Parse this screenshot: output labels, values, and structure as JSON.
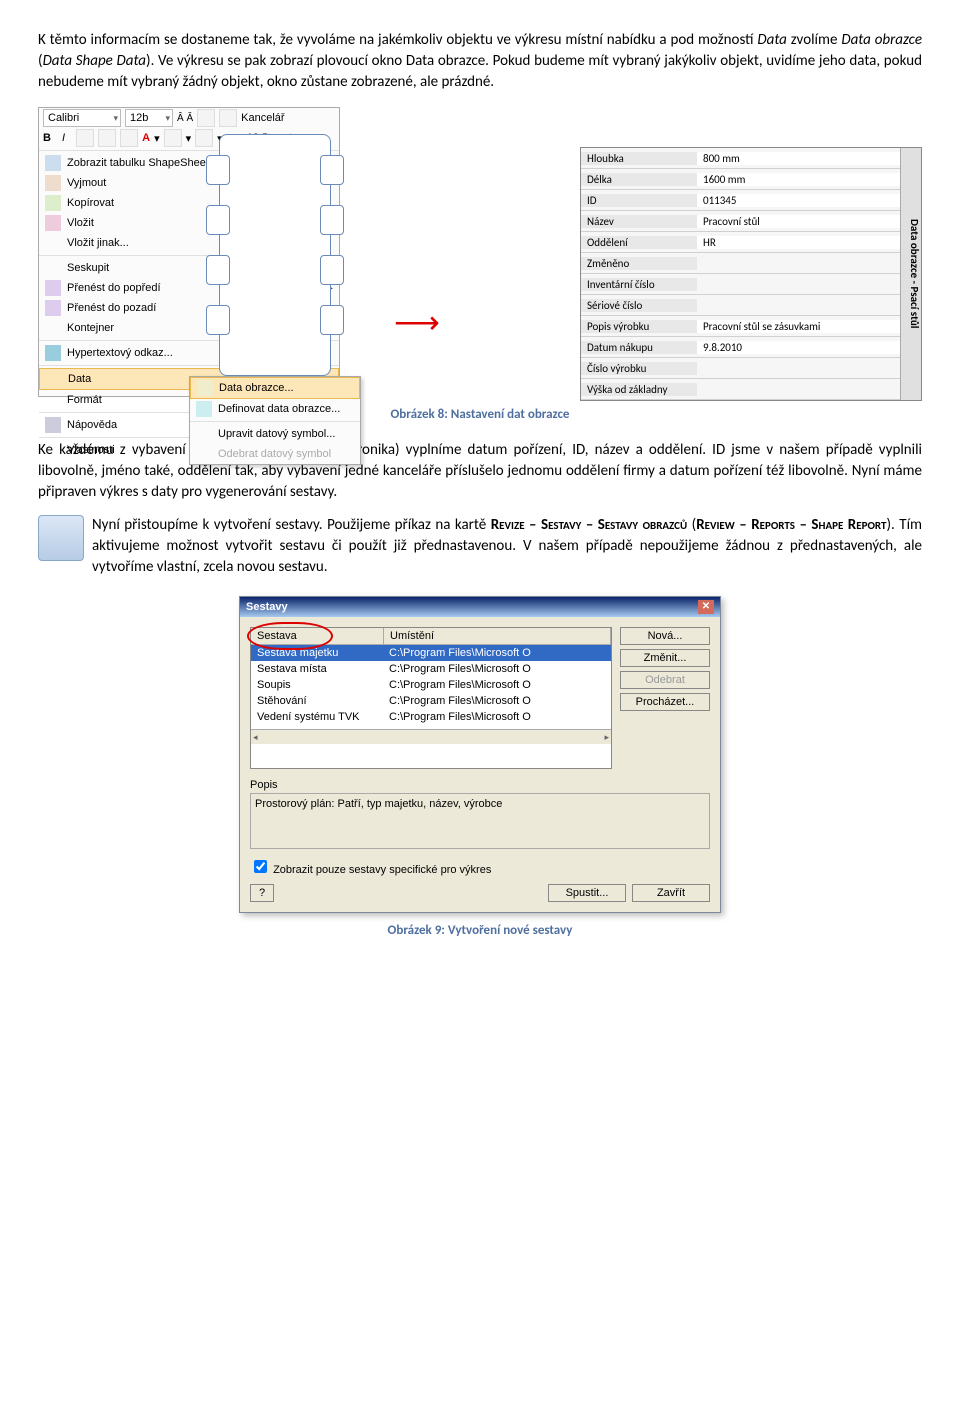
{
  "p1": {
    "t1": "K těmto informacím se dostaneme tak, že vyvoláme na jakémkoliv objektu ve výkresu místní nabídku a pod možností ",
    "i1": "Data",
    "t2": " zvolíme ",
    "i2": "Data obrazce",
    "t3": " (",
    "i3": "Data",
    "t4": " ",
    "i4": "Shape Data",
    "t5": "). Ve výkresu se pak zobrazí plovoucí okno Data obrazce. Pokud budeme mít vybraný jakýkoliv objekt, uvidíme jeho data, pokud nebudeme mít vybraný žádný objekt, okno zůstane zobrazené, ale prázdné."
  },
  "toolbar": {
    "font": "Calibri",
    "size": "12b",
    "misc": "Kancelář",
    "ruler": "18 čt metry"
  },
  "menu": {
    "items": [
      "Zobrazit tabulku ShapeSheet",
      "Vyjmout",
      "Kopírovat",
      "Vložit",
      "Vložit jinak...",
      "Seskupit",
      "Přenést do popředí",
      "Přenést do pozadí",
      "Kontejner",
      "Hypertextový odkaz...",
      "Data",
      "Formát",
      "Nápověda",
      "Vlastnosti"
    ],
    "sub": [
      "Data obrazce...",
      "Definovat data obrazce...",
      "Upravit datový symbol...",
      "Odebrat datový symbol"
    ]
  },
  "datapane": {
    "title": "Data obrazce - Psací stůl",
    "rows": [
      [
        "Hloubka",
        "800 mm"
      ],
      [
        "Délka",
        "1600 mm"
      ],
      [
        "ID",
        "011345"
      ],
      [
        "Název",
        "Pracovní stůl"
      ],
      [
        "Oddělení",
        "HR"
      ],
      [
        "Změněno",
        ""
      ],
      [
        "Inventární číslo",
        ""
      ],
      [
        "Sériové číslo",
        ""
      ],
      [
        "Popis výrobku",
        "Pracovní stůl se zásuvkami"
      ],
      [
        "Datum nákupu",
        "9.8.2010"
      ],
      [
        "Číslo výrobku",
        ""
      ],
      [
        "Výška od základny",
        ""
      ]
    ]
  },
  "cap1": "Obrázek 8: Nastavení dat obrazce",
  "p2": "Ke každému z vybavení (ať už nábytek nebo elektronika) vyplníme datum pořízení, ID, název a oddělení. ID jsme v našem případě vyplnili libovolně, jméno také, oddělení tak, aby vybavení jedné kanceláře příslušelo jednomu oddělení firmy a datum pořízení též libovolně. Nyní máme připraven výkres s daty pro vygenerování sestavy.",
  "p3": {
    "t1": "Nyní přistoupíme k vytvoření sestavy. Použijeme příkaz na kartě ",
    "sc1": "Revize – Sestavy – Sestavy obrazců",
    "t2": " (",
    "sc2": "Review – Reports – Shape Report",
    "t3": "). Tím aktivujeme možnost vytvořit sestavu či použít již přednastavenou. V našem případě nepoužijeme žádnou z přednastavených, ale vytvoříme vlastní, zcela novou sestavu."
  },
  "dialog": {
    "title": "Sestavy",
    "cols": [
      "Sestava",
      "Umístění"
    ],
    "rows": [
      [
        "Sestava majetku",
        "C:\\Program Files\\Microsoft O"
      ],
      [
        "Sestava místa",
        "C:\\Program Files\\Microsoft O"
      ],
      [
        "Soupis",
        "C:\\Program Files\\Microsoft O"
      ],
      [
        "Stěhování",
        "C:\\Program Files\\Microsoft O"
      ],
      [
        "Vedení systému TVK",
        "C:\\Program Files\\Microsoft O"
      ]
    ],
    "btns": {
      "nova": "Nová...",
      "zmenit": "Změnit...",
      "odebrat": "Odebrat",
      "prochazet": "Procházet..."
    },
    "popis_lbl": "Popis",
    "popis": "Prostorový plán: Patří, typ majetku, název, výrobce",
    "chk": "Zobrazit pouze sestavy specifické pro výkres",
    "spustit": "Spustit...",
    "zavrit": "Zavřít"
  },
  "cap2": "Obrázek 9: Vytvoření nové sestavy"
}
